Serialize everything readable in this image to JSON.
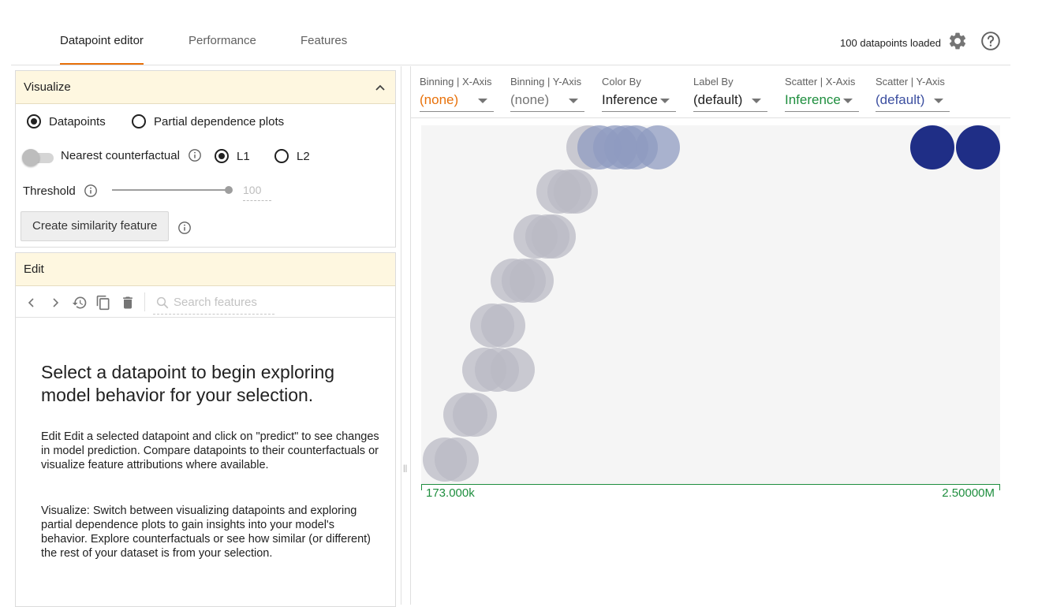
{
  "tabs": [
    {
      "label": "Datapoint editor"
    },
    {
      "label": "Performance"
    },
    {
      "label": "Features"
    }
  ],
  "status": {
    "loaded": "100 datapoints loaded"
  },
  "visualize": {
    "title": "Visualize",
    "datapoints_label": "Datapoints",
    "pdp_label": "Partial dependence plots",
    "nearest_label": "Nearest counterfactual",
    "l1_label": "L1",
    "l2_label": "L2",
    "threshold_label": "Threshold",
    "threshold_value": "100",
    "threshold_level": 1.0,
    "similarity_button": "Create similarity feature"
  },
  "edit": {
    "title": "Edit",
    "search_placeholder": "Search features",
    "heading": "Select a datapoint to begin exploring model behavior for your selection.",
    "paragraph1": "Edit Edit a selected datapoint and click on \"predict\" to see changes in model prediction. Compare datapoints to their counterfactuals or visualize feature attributions where available.",
    "paragraph2": "Visualize: Switch between visualizing datapoints and exploring partial dependence plots to gain insights into your model's behavior. Explore counterfactuals or see how similar (or different) the rest of your dataset is from your selection."
  },
  "controls": [
    {
      "label": "Binning | X-Axis",
      "value": "(none)",
      "color": "#e8710a"
    },
    {
      "label": "Binning | Y-Axis",
      "value": "(none)",
      "color": "#757575"
    },
    {
      "label": "Color By",
      "value": "Inference",
      "color": "#212121"
    },
    {
      "label": "Label By",
      "value": "(default)",
      "color": "#212121"
    },
    {
      "label": "Scatter | X-Axis",
      "value": "Inference",
      "color": "#1e8e3e"
    },
    {
      "label": "Scatter | Y-Axis",
      "value": "(default)",
      "color": "#3c4fa0"
    }
  ],
  "chart_data": {
    "type": "scatter",
    "x_axis_min_label": "173.000k",
    "x_axis_max_label": "2.50000M",
    "colors": {
      "low": "#b9b9c4",
      "mid": "#8f9bc0",
      "high": "#1f2e86"
    }
  }
}
